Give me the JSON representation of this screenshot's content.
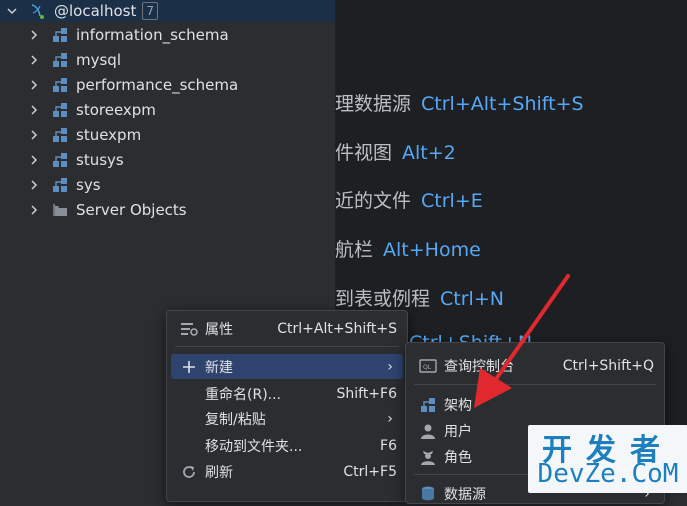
{
  "tree": {
    "root": {
      "label": "@localhost",
      "badge": "7"
    },
    "items": [
      {
        "label": "information_schema"
      },
      {
        "label": "mysql"
      },
      {
        "label": "performance_schema"
      },
      {
        "label": "storeexpm"
      },
      {
        "label": "stuexpm"
      },
      {
        "label": "stusys"
      },
      {
        "label": "sys"
      },
      {
        "label": "Server Objects"
      }
    ]
  },
  "hints": [
    {
      "text": "理数据源",
      "key": "Ctrl+Alt+Shift+S"
    },
    {
      "text": "件视图",
      "key": "Alt+2"
    },
    {
      "text": "近的文件",
      "key": "Ctrl+E"
    },
    {
      "text": "航栏",
      "key": "Alt+Home"
    },
    {
      "text": "到表或例程",
      "key": "Ctrl+N"
    },
    {
      "text": "",
      "key": "Ctrl+Shift+N"
    }
  ],
  "context_menu": {
    "items": [
      {
        "label": "属性",
        "shortcut": "Ctrl+Alt+Shift+S",
        "icon": "properties-icon"
      },
      {
        "label": "新建",
        "shortcut": "",
        "icon": "plus-icon",
        "submenu": true,
        "active": true
      },
      {
        "label": "重命名(R)...",
        "shortcut": "Shift+F6",
        "icon": ""
      },
      {
        "label": "复制/粘贴",
        "shortcut": "",
        "icon": "",
        "submenu": true
      },
      {
        "label": "移动到文件夹...",
        "shortcut": "F6",
        "icon": ""
      },
      {
        "label": "刷新",
        "shortcut": "Ctrl+F5",
        "icon": "refresh-icon"
      }
    ]
  },
  "submenu": {
    "items": [
      {
        "label": "查询控制台",
        "shortcut": "Ctrl+Shift+Q",
        "icon": "query-console-icon"
      },
      {
        "label": "架构",
        "shortcut": "",
        "icon": "schema-icon"
      },
      {
        "label": "用户",
        "shortcut": "",
        "icon": "user-icon"
      },
      {
        "label": "角色",
        "shortcut": "",
        "icon": "role-icon"
      },
      {
        "label": "数据源",
        "shortcut": "",
        "icon": "datasource-icon",
        "submenu": true
      }
    ]
  },
  "watermark": {
    "cn": "开发者",
    "en": "DevZe.CoM"
  },
  "colors": {
    "accent": "#56a8f5",
    "selection": "#2e436e",
    "arrow": "#e0282e"
  }
}
